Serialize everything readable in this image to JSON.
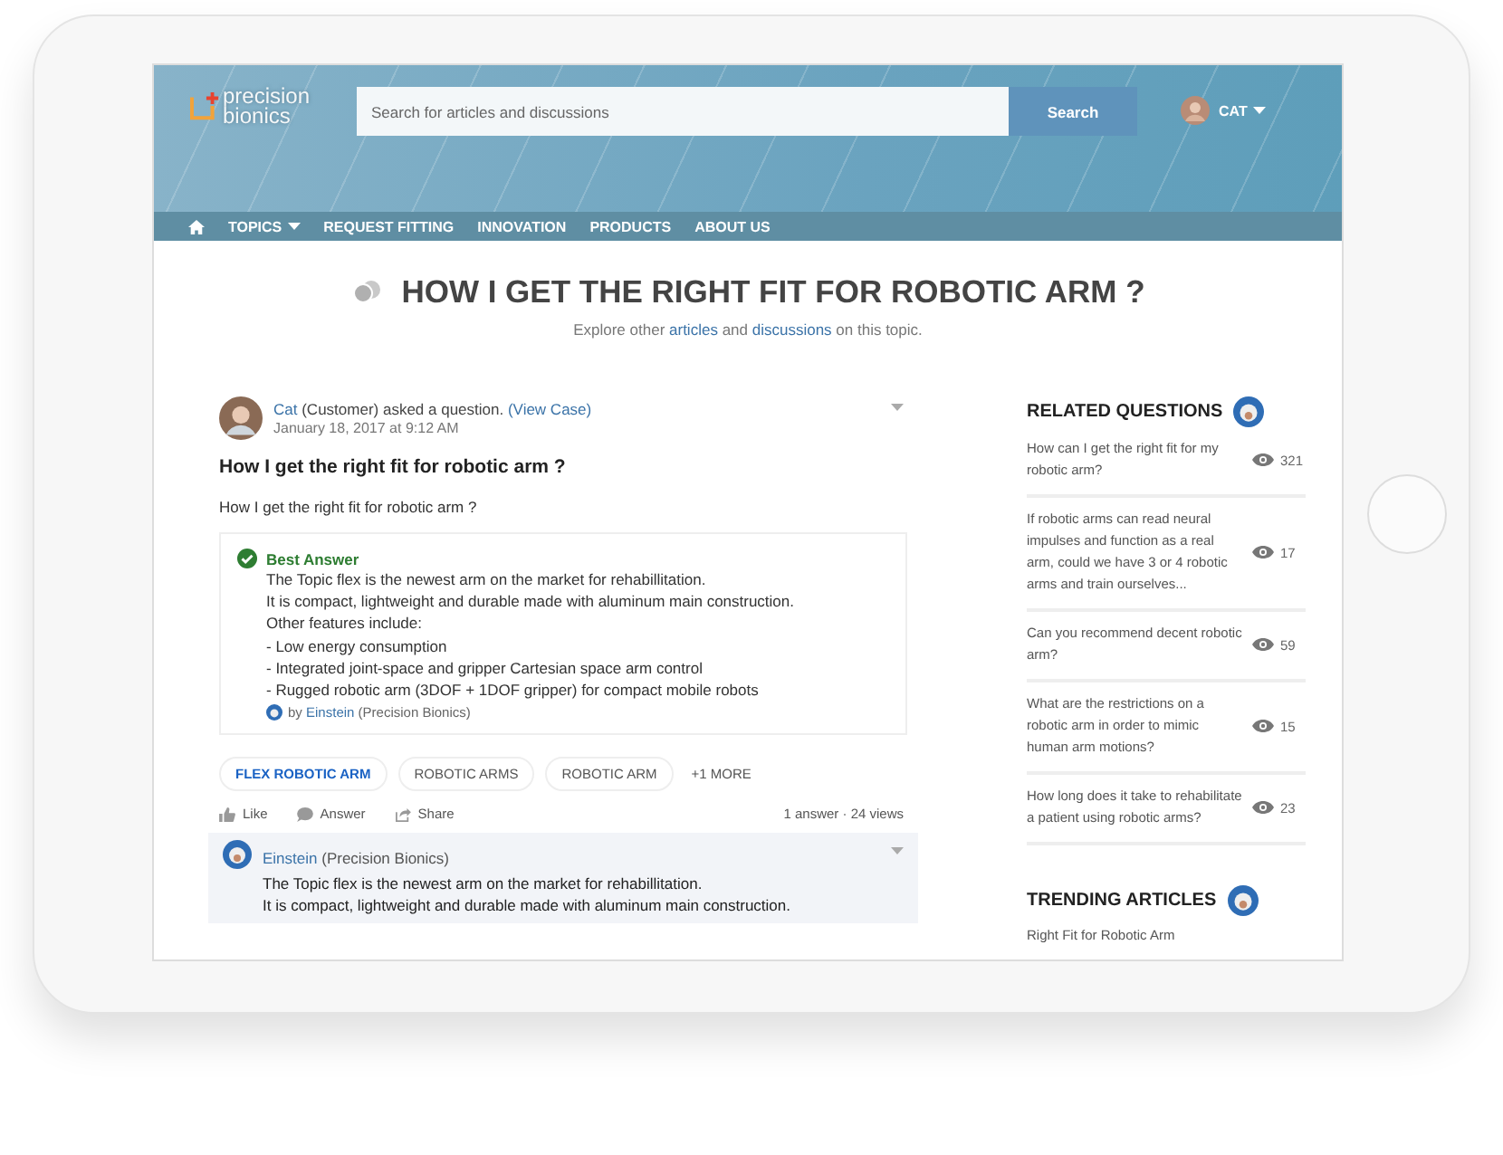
{
  "brand": {
    "line1": "precision",
    "line2": "bionics"
  },
  "search": {
    "placeholder": "Search for articles and discussions",
    "button": "Search"
  },
  "user": {
    "name": "CAT"
  },
  "nav": [
    {
      "label": "TOPICS",
      "dropdown": true
    },
    {
      "label": "REQUEST FITTING",
      "dropdown": false
    },
    {
      "label": "INNOVATION",
      "dropdown": false
    },
    {
      "label": "PRODUCTS",
      "dropdown": false
    },
    {
      "label": "ABOUT US",
      "dropdown": false
    }
  ],
  "page_title": "HOW I GET THE RIGHT FIT FOR ROBOTIC ARM ?",
  "subtitle": {
    "before": "Explore other",
    "link1": "articles",
    "middle": "and",
    "link2": "discussions",
    "after": "on this topic."
  },
  "question": {
    "author": "Cat",
    "action": "(Customer) asked a question.",
    "case_link": "(View Case)",
    "date": "January 18, 2017 at 9:12 AM",
    "title": "How I get the right fit for robotic arm ?",
    "body": "How I get the right fit for robotic arm ?"
  },
  "best_answer": {
    "label": "Best Answer",
    "lines": [
      "The Topic flex is the newest arm on the market for rehabillitation.",
      "It is compact, lightweight and durable made with aluminum main construction.",
      "Other features include:",
      "- Low energy consumption",
      "- Integrated joint-space and gripper Cartesian space arm control",
      "- Rugged robotic arm (3DOF + 1DOF gripper) for compact mobile robots"
    ],
    "by": "by",
    "author": "Einstein",
    "org": "(Precision Bionics)"
  },
  "tags": [
    {
      "label": "FLEX ROBOTIC ARM",
      "selected": true
    },
    {
      "label": "ROBOTIC ARMS",
      "selected": false
    },
    {
      "label": "ROBOTIC ARM",
      "selected": false
    }
  ],
  "more_tags": "+1 MORE",
  "actions": [
    {
      "kind": "like",
      "label": "Like"
    },
    {
      "kind": "answer",
      "label": "Answer"
    },
    {
      "kind": "share",
      "label": "Share"
    }
  ],
  "stats": "1 answer · 24 views",
  "answer": {
    "author": "Einstein",
    "org": "(Precision Bionics)",
    "lines": [
      "The Topic flex is the newest arm on the market for rehabillitation.",
      "It is compact, lightweight and durable made with aluminum main construction."
    ]
  },
  "related": {
    "title": "RELATED QUESTIONS",
    "items": [
      {
        "text": "How can I get the right fit for my robotic arm?",
        "views": "321"
      },
      {
        "text": "If robotic arms can read neural impulses and function as a real arm, could we have 3 or 4 robotic arms and train ourselves...",
        "views": "17"
      },
      {
        "text": "Can you recommend decent robotic arm?",
        "views": "59"
      },
      {
        "text": "What are the restrictions on a robotic arm in order to mimic human arm motions?",
        "views": "15"
      },
      {
        "text": "How long does it take to rehabilitate a patient using robotic arms?",
        "views": "23"
      }
    ]
  },
  "trending": {
    "title": "TRENDING ARTICLES",
    "items": [
      "Right Fit for Robotic Arm"
    ]
  }
}
